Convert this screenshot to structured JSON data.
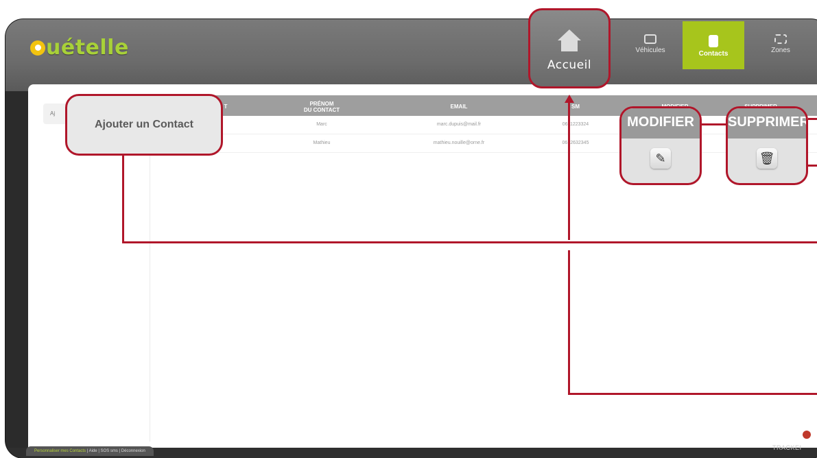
{
  "app": {
    "logo_text": "uételle"
  },
  "nav": {
    "home_label": "Accueil",
    "vehicules_label": "Véhicules",
    "contacts_label": "Contacts",
    "zones_label": "Zones"
  },
  "sidebar": {
    "add_contact_label": "Ajouter un Contact",
    "tab_fragment": "Aj"
  },
  "table": {
    "headers": {
      "col1": "T",
      "prenom_line1": "PRÉNOM",
      "prenom_line2": "DU CONTACT",
      "email": "EMAIL",
      "sms": "SM",
      "modifier": "MODIFIER",
      "supprimer": "SUPPRIMER"
    },
    "rows": [
      {
        "prenom": "Marc",
        "email": "marc.dupuis@mail.fr",
        "sms": "0611223324"
      },
      {
        "prenom": "Mathieu",
        "email": "mathieu.nouille@orne.fr",
        "sms": "0612632345"
      }
    ]
  },
  "callouts": {
    "modifier_head": "MODIFIER",
    "supprimer_head": "SUPPRIMER",
    "edit_icon": "pencil-icon",
    "delete_icon": "trash-icon"
  },
  "footer": {
    "link_current": "Personnaliser mes Contacts",
    "link_aide": "Aide",
    "link_sos": "SOS sms",
    "link_deconnexion": "Déconnexion",
    "brand": "TRACKEI"
  },
  "colors": {
    "accent_green": "#a7c51c",
    "callout_red": "#b0162a",
    "logo_yellow": "#f2c30f"
  }
}
